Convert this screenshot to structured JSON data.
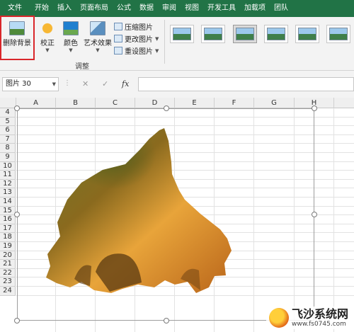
{
  "menu": {
    "tabs": [
      "文件",
      "开始",
      "插入",
      "页面布局",
      "公式",
      "数据",
      "审阅",
      "视图",
      "开发工具",
      "加载项",
      "团队"
    ],
    "active": ""
  },
  "ribbon": {
    "remove_bg": "删除背景",
    "correct": "校正",
    "color": "颜色",
    "art_effects": "艺术效果",
    "compress": "压缩图片",
    "change": "更改图片",
    "reset": "重设图片",
    "group_label": "调整",
    "highlight_color": "#d9262a"
  },
  "formula_bar": {
    "name_box": "图片 30",
    "cancel": "✕",
    "enter": "✓",
    "fx": "fx",
    "value": ""
  },
  "sheet": {
    "columns": [
      "A",
      "B",
      "C",
      "D",
      "E",
      "F",
      "G",
      "H"
    ],
    "rows": [
      "4",
      "5",
      "6",
      "7",
      "8",
      "9",
      "10",
      "11",
      "12",
      "13",
      "14",
      "15",
      "16",
      "17",
      "18",
      "19",
      "20",
      "21",
      "22",
      "23",
      "24"
    ]
  },
  "watermark": {
    "title": "飞沙系统网",
    "url": "www.fs0745.com"
  },
  "colors": {
    "brand": "#217346",
    "rock_dark": "#5a3a12",
    "rock_light": "#e8a43a",
    "moss": "#6f7a2a"
  }
}
